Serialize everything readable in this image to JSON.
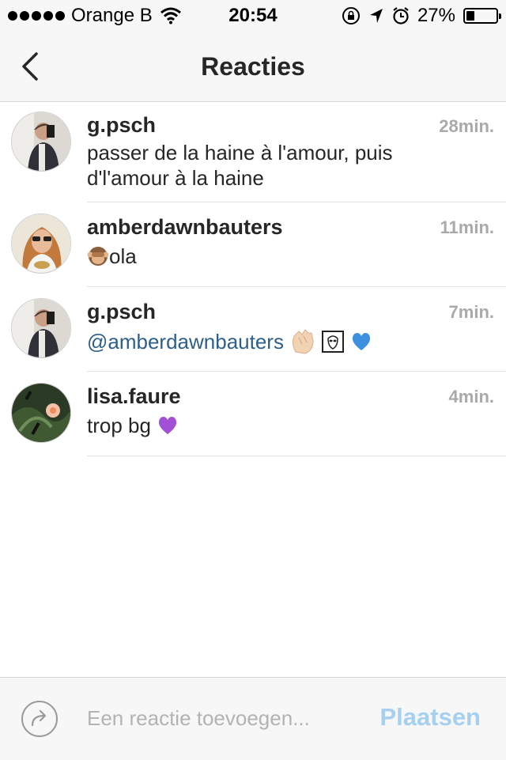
{
  "status_bar": {
    "carrier": "Orange B",
    "time": "20:54",
    "battery_percent": "27%",
    "battery_level": 0.27,
    "icons": [
      "signal-dots-icon",
      "wifi-icon",
      "orientation-lock-icon",
      "location-arrow-icon",
      "alarm-icon",
      "battery-icon"
    ]
  },
  "nav": {
    "title": "Reacties",
    "back_icon": "chevron-left-icon"
  },
  "comments": [
    {
      "username": "g.psch",
      "time": "28min.",
      "text": "passer de la haine à l'amour, puis d'l'amour à la haine",
      "avatar": "avatar-man-mirror-selfie"
    },
    {
      "username": "amberdawnbauters",
      "time": "11min.",
      "text": "ola",
      "prefix_emoji": "see-no-evil-monkey-emoji",
      "avatar": "avatar-woman-sunglasses"
    },
    {
      "username": "g.psch",
      "time": "7min.",
      "mention": "@amberdawnbauters",
      "emojis": [
        "clapping-hands-emoji",
        "alien-emoji",
        "blue-heart-emoji"
      ],
      "avatar": "avatar-man-mirror-selfie"
    },
    {
      "username": "lisa.faure",
      "time": "4min.",
      "text": "trop bg",
      "suffix_emoji": "purple-heart-emoji",
      "avatar": "avatar-flowers-foliage"
    }
  ],
  "composer": {
    "placeholder": "Een reactie toevoegen...",
    "post_label": "Plaatsen",
    "share_icon": "share-arrow-icon"
  },
  "colors": {
    "bar_bg": "#f7f7f7",
    "text": "#262626",
    "timestamp": "#a9a9a9",
    "mention": "#2d5f8a",
    "post_button_disabled": "#a6d0f0"
  }
}
